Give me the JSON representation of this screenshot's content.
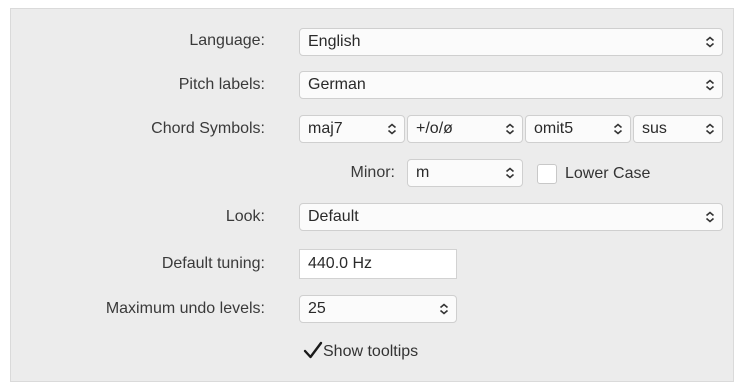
{
  "labels": {
    "language": "Language:",
    "pitch_labels": "Pitch labels:",
    "chord_symbols": "Chord Symbols:",
    "minor": "Minor:",
    "look": "Look:",
    "default_tuning": "Default tuning:",
    "maximum_undo_levels": "Maximum undo levels:"
  },
  "selects": {
    "language": "English",
    "pitch_labels": "German",
    "chord_major7": "maj7",
    "chord_diminished": "+/o/ø",
    "chord_omit": "omit5",
    "chord_sus": "sus",
    "minor": "m",
    "look": "Default",
    "undo_levels": "25"
  },
  "inputs": {
    "default_tuning": "440.0 Hz"
  },
  "checkboxes": {
    "lower_case": {
      "label": "Lower Case",
      "checked": false
    },
    "show_tooltips": {
      "label": "Show tooltips",
      "checked": true
    }
  }
}
